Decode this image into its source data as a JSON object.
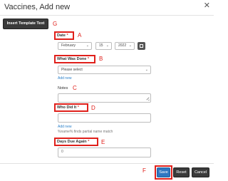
{
  "dialog": {
    "title": "Vaccines, Add new",
    "close_icon": "close-icon"
  },
  "toolbar": {
    "template_button": "Insert Template Text"
  },
  "annotations": [
    "A",
    "B",
    "C",
    "D",
    "E",
    "F",
    "G"
  ],
  "fields": {
    "date": {
      "label": "Date",
      "required_mark": "*",
      "month": "February",
      "day": "15",
      "year": "2022",
      "calendar_icon": "calendar-icon"
    },
    "what_was_done": {
      "label": "What Was Done",
      "required_mark": "*",
      "value": "Please select",
      "add_link": "Add new"
    },
    "notes": {
      "label": "Notes"
    },
    "who_did_it": {
      "label": "Who Did It",
      "required_mark": "*",
      "add_link": "Add new",
      "hint": "%name% finds partial name match"
    },
    "days_due_again": {
      "label": "Days Due Again",
      "required_mark": "*",
      "value": "0"
    }
  },
  "footer": {
    "save": "Save",
    "reset": "Reset",
    "cancel": "Cancel"
  },
  "colors": {
    "annotation": "#e0201b",
    "primary": "#2f77c2",
    "dark_button": "#3a3a3a",
    "link": "#2a7fc9"
  }
}
